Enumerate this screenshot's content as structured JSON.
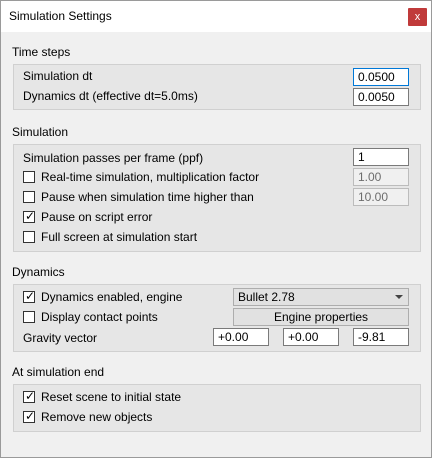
{
  "window": {
    "title": "Simulation Settings",
    "close_glyph": "x"
  },
  "time_steps": {
    "title": "Time steps",
    "sim_dt_label": "Simulation dt",
    "sim_dt_value": "0.0500",
    "dyn_dt_label": "Dynamics dt (effective dt=5.0ms)",
    "dyn_dt_value": "0.0050"
  },
  "simulation": {
    "title": "Simulation",
    "ppf_label": "Simulation passes per frame (ppf)",
    "ppf_value": "1",
    "realtime_label": "Real-time simulation, multiplication factor",
    "realtime_checked": false,
    "realtime_value": "1.00",
    "pause_time_label": "Pause when simulation time higher than",
    "pause_time_checked": false,
    "pause_time_value": "10.00",
    "pause_error_label": "Pause on script error",
    "pause_error_checked": true,
    "fullscreen_label": "Full screen at simulation start",
    "fullscreen_checked": false
  },
  "dynamics": {
    "title": "Dynamics",
    "enabled_label": "Dynamics enabled, engine",
    "enabled_checked": true,
    "engine_value": "Bullet 2.78",
    "contact_label": "Display contact points",
    "contact_checked": false,
    "engine_props_label": "Engine properties",
    "gravity_label": "Gravity vector",
    "gravity_x": "+0.00",
    "gravity_y": "+0.00",
    "gravity_z": "-9.81"
  },
  "sim_end": {
    "title": "At simulation end",
    "reset_label": "Reset scene to initial state",
    "reset_checked": true,
    "remove_label": "Remove new objects",
    "remove_checked": true
  },
  "icons": {
    "check": "check-icon",
    "dropdown": "chevron-down-icon",
    "close": "close-icon"
  },
  "colors": {
    "close_bg": "#c03a3a",
    "focus_border": "#0078d7",
    "group_bg": "#e6e6e6"
  }
}
